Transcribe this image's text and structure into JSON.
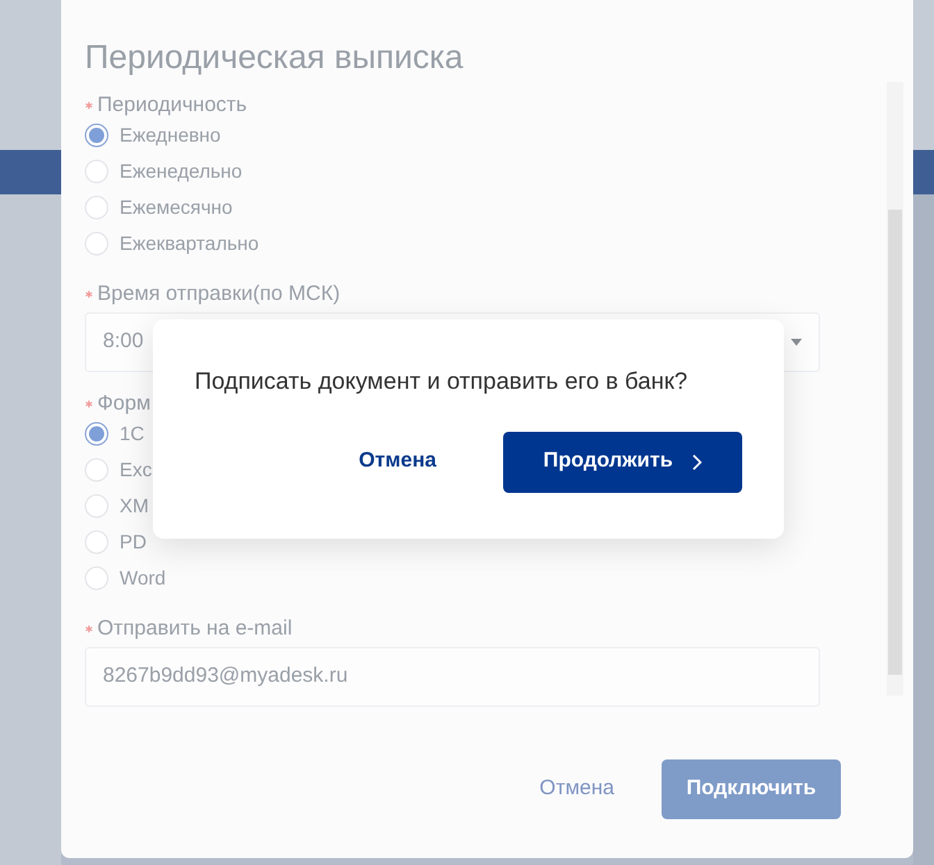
{
  "dialog": {
    "title": "Периодическая выписка",
    "fields": [
      {
        "kind": "radio",
        "label": "Периодичность",
        "required": true,
        "options": [
          {
            "label": "Ежедневно",
            "selected": true
          },
          {
            "label": "Еженедельно",
            "selected": false
          },
          {
            "label": "Ежемесячно",
            "selected": false
          },
          {
            "label": "Ежеквартально",
            "selected": false
          }
        ]
      },
      {
        "kind": "select",
        "label": "Время отправки(по МСК)",
        "required": true,
        "value": "8:00"
      },
      {
        "kind": "radio",
        "label": "Форм",
        "required": true,
        "options": [
          {
            "label": "1С",
            "selected": true
          },
          {
            "label": "Exc",
            "selected": false
          },
          {
            "label": "XM",
            "selected": false
          },
          {
            "label": "PD",
            "selected": false
          },
          {
            "label": "Word",
            "selected": false
          }
        ]
      },
      {
        "kind": "input",
        "label": "Отправить на e-mail",
        "required": true,
        "value": "8267b9dd93@myadesk.ru"
      }
    ],
    "buttons": [
      {
        "kind": "link",
        "label": "Отмена"
      },
      {
        "kind": "primary",
        "label": "Подключить"
      }
    ]
  },
  "confirm": {
    "message": "Подписать документ и отправить его в банк?",
    "buttons": [
      {
        "kind": "link",
        "label": "Отмена"
      },
      {
        "kind": "primary",
        "label": "Продолжить"
      }
    ]
  }
}
